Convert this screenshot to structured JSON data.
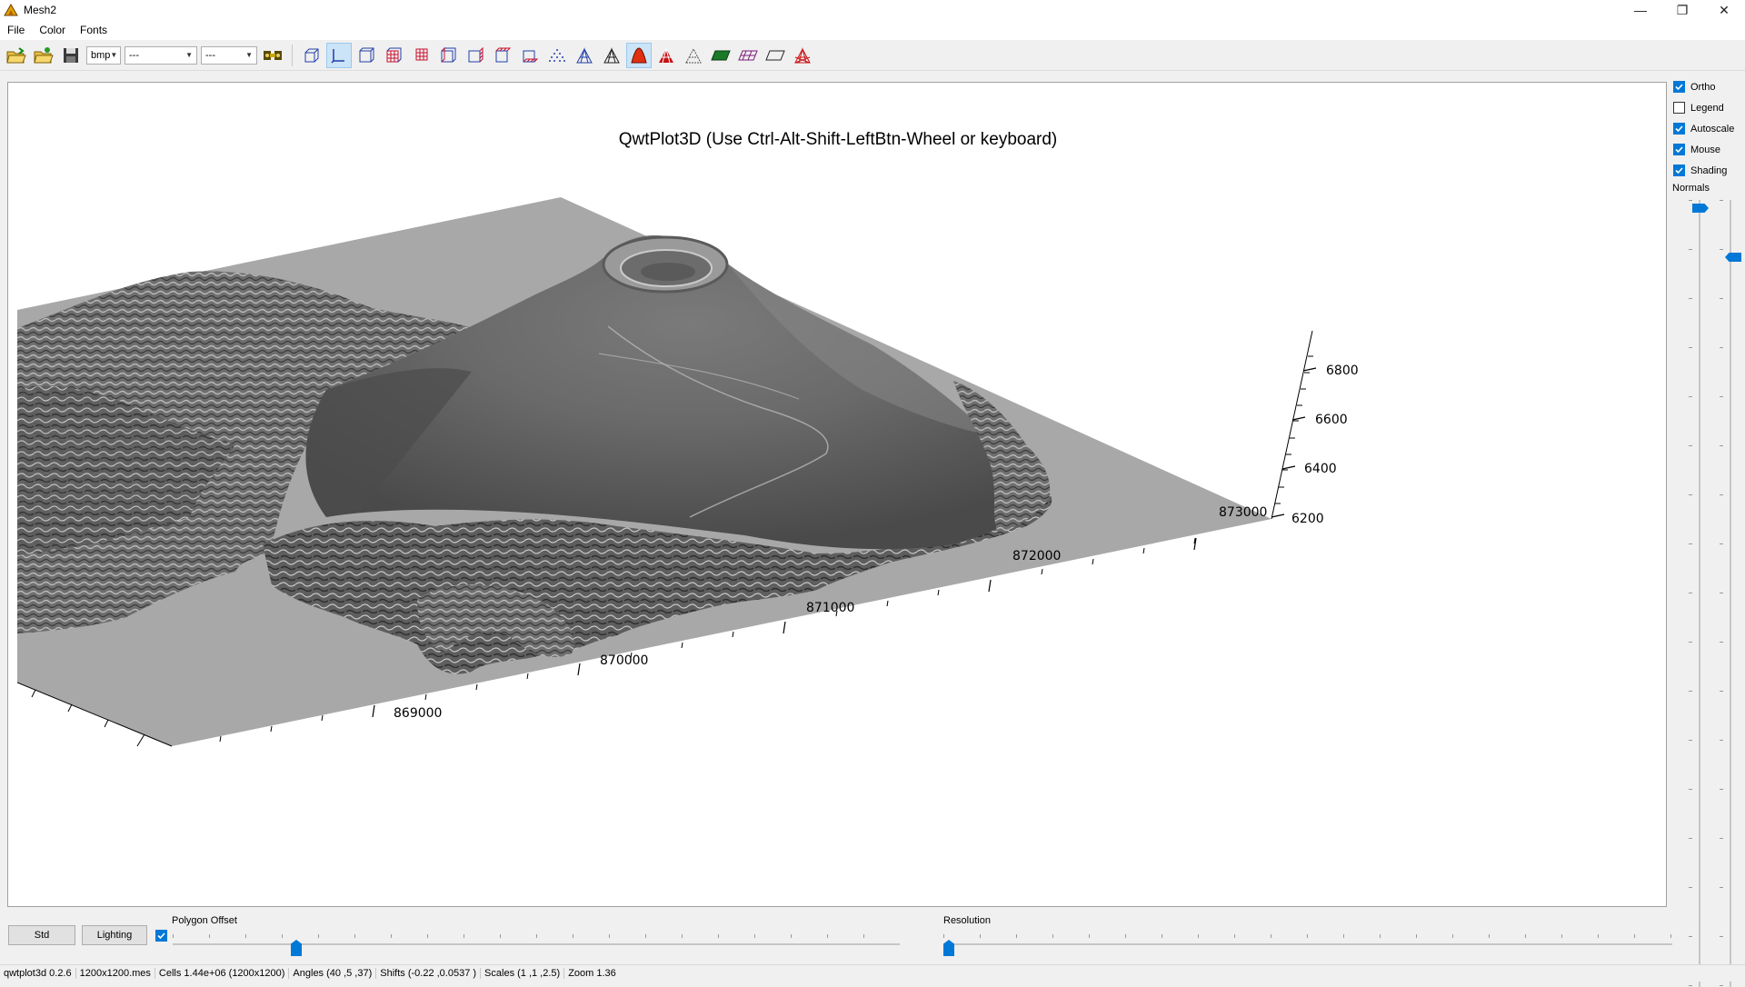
{
  "window": {
    "title": "Mesh2",
    "minimize": "—",
    "restore": "❐",
    "close": "✕"
  },
  "menu": {
    "file": "File",
    "color": "Color",
    "fonts": "Fonts"
  },
  "toolbar": {
    "format_combo": "bmp",
    "combo2": "---",
    "combo3": "---"
  },
  "plot": {
    "title": "QwtPlot3D (Use Ctrl-Alt-Shift-LeftBtn-Wheel or keyboard)",
    "x_ticks": [
      "869000",
      "870000",
      "871000",
      "872000",
      "873000"
    ],
    "z_ticks": [
      "6200",
      "6400",
      "6600",
      "6800"
    ]
  },
  "side": {
    "ortho": "Ortho",
    "legend": "Legend",
    "autoscale": "Autoscale",
    "mouse": "Mouse",
    "shading": "Shading",
    "normals": "Normals",
    "ortho_checked": true,
    "legend_checked": false,
    "autoscale_checked": true,
    "mouse_checked": true,
    "shading_checked": true
  },
  "bottom": {
    "std_button": "Std",
    "lighting_button": "Lighting",
    "polygon_offset_label": "Polygon Offset",
    "resolution_label": "Resolution",
    "polygon_offset_checked": true
  },
  "status": {
    "version": "qwtplot3d 0.2.6",
    "file": "1200x1200.mes",
    "cells": "Cells 1.44e+06 (1200x1200)",
    "angles": "Angles (40 ,5 ,37)",
    "shifts": "Shifts (-0.22 ,0.0537 )",
    "scales": "Scales (1 ,1 ,2.5)",
    "zoom": "Zoom 1.36"
  },
  "colors": {
    "accent": "#0078d7",
    "surface_dark": "#5a5a5a",
    "surface_light": "#9a9a9a",
    "plane": "#a8a8a8"
  }
}
